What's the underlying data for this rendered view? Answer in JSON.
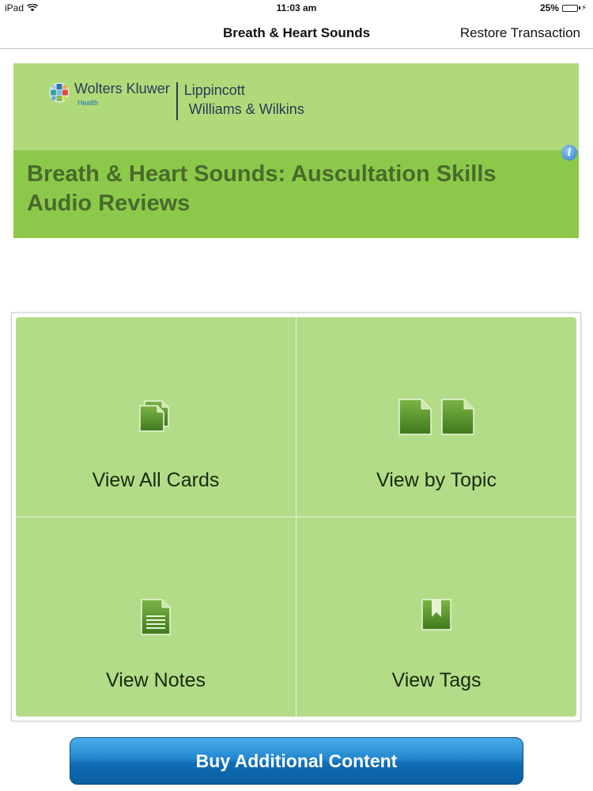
{
  "status_bar": {
    "device": "iPad",
    "time": "11:03 am",
    "battery": "25%",
    "battery_level": 0.25
  },
  "nav": {
    "title": "Breath & Heart Sounds",
    "right_button": "Restore Transaction"
  },
  "banner": {
    "logo": {
      "wk_name": "Wolters Kluwer",
      "wk_health": "Health",
      "lww_line1": "Lippincott",
      "lww_line2": "Williams & Wilkins"
    },
    "title": "Breath & Heart Sounds: Auscultation Skills Audio Reviews",
    "info_icon": "i"
  },
  "tiles": [
    {
      "label": "View All Cards",
      "icon": "stacked-cards-icon"
    },
    {
      "label": "View by Topic",
      "icon": "two-documents-icon"
    },
    {
      "label": "View Notes",
      "icon": "note-document-icon"
    },
    {
      "label": "View Tags",
      "icon": "bookmark-tag-icon"
    }
  ],
  "buy_button": {
    "label": "Buy Additional Content"
  },
  "colors": {
    "banner_light": "#b0d97a",
    "banner_dark": "#8cc94a",
    "tile": "#b3dc88",
    "button": "#2386cf",
    "icon_green": "#5d9a2e"
  }
}
